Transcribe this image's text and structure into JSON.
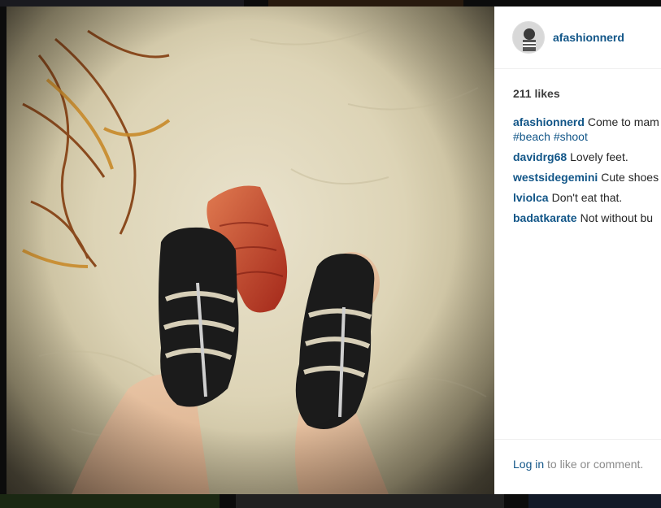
{
  "post": {
    "username": "afashionnerd",
    "likes_label": "211 likes",
    "caption": {
      "author": "afashionnerd",
      "text": "Come to mam",
      "hashtags": [
        "#beach",
        "#shoot"
      ]
    },
    "comments": [
      {
        "author": "davidrg68",
        "text": "Lovely feet."
      },
      {
        "author": "westsidegemini",
        "text": "Cute shoes"
      },
      {
        "author": "lviolca",
        "text": "Don't eat that."
      },
      {
        "author": "badatkarate",
        "text": "Not without bu"
      }
    ],
    "footer": {
      "login_label": "Log in",
      "rest_text": "to like or comment."
    }
  },
  "icons": {
    "avatar": "user-avatar-photo",
    "photo": "sandals-on-beach-photo"
  },
  "colors": {
    "link": "#125688",
    "text": "#262626",
    "muted": "#8a8a8a",
    "backdrop": "#1c1c1c"
  }
}
